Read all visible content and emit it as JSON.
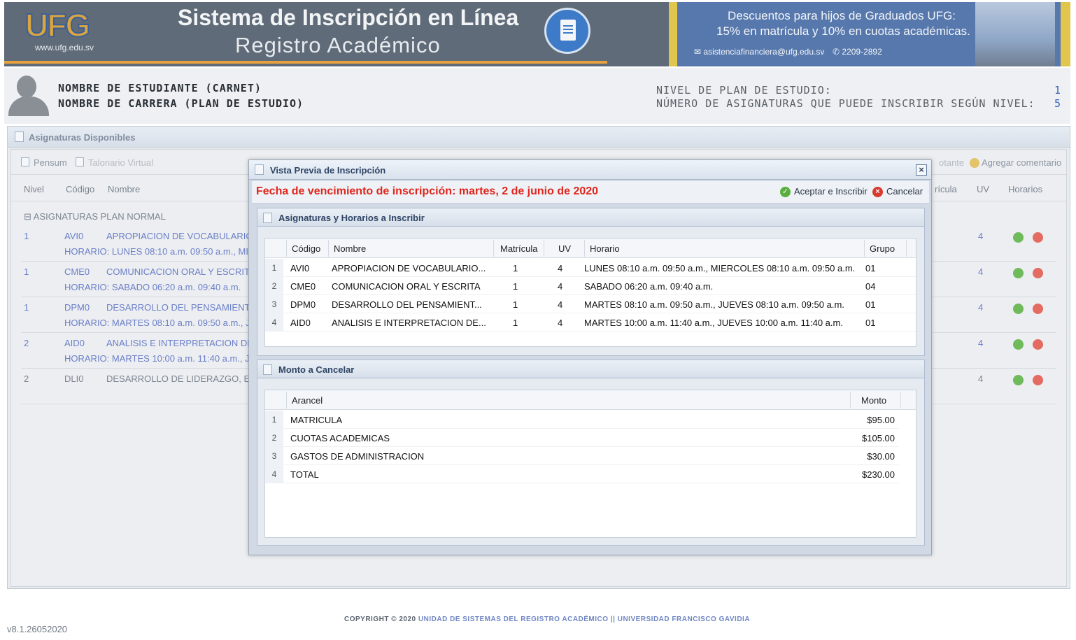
{
  "header": {
    "logo_text": "UFG",
    "logo_url": "www.ufg.edu.sv",
    "title": "Sistema de Inscripción en Línea",
    "subtitle": "Registro Académico",
    "promo_line1": "Descuentos para hijos de Graduados UFG:",
    "promo_line2": "15% en matrícula y 10% en cuotas académicas.",
    "promo_email": "asistenciafinanciera@ufg.edu.sv",
    "promo_phone": "2209-2892"
  },
  "student": {
    "name": "NOMBRE DE ESTUDIANTE (CARNET)",
    "career": "NOMBRE DE CARRERA (PLAN DE ESTUDIO)",
    "level_label": "NIVEL DE PLAN DE ESTUDIO:",
    "level_value": "1",
    "max_label": "NÚMERO DE ASIGNATURAS QUE PUEDE INSCRIBIR SEGÚN NIVEL:",
    "max_value": "5"
  },
  "background_panel": {
    "title": "Asignaturas Disponibles",
    "toolbar": {
      "pensum": "Pensum",
      "talonario": "Talonario Virtual",
      "cancel_partial": "otante",
      "comment": "Agregar comentario"
    },
    "columns": {
      "nivel": "Nivel",
      "codigo": "Código",
      "nombre": "Nombre",
      "matricula_partial": "rícula",
      "uv": "UV",
      "horarios": "Horarios"
    },
    "group_title": "ASIGNATURAS PLAN NORMAL",
    "rows": [
      {
        "nivel": "1",
        "codigo": "AVI0",
        "nombre": "APROPIACION DE VOCABULARIO",
        "horario": "HORARIO: LUNES 08:10 a.m. 09:50 a.m., MIE",
        "uv": "4"
      },
      {
        "nivel": "1",
        "codigo": "CME0",
        "nombre": "COMUNICACION ORAL Y ESCRITA",
        "horario": "HORARIO: SABADO 06:20 a.m. 09:40 a.m.",
        "uv": "4"
      },
      {
        "nivel": "1",
        "codigo": "DPM0",
        "nombre": "DESARROLLO DEL PENSAMIENT",
        "horario": "HORARIO: MARTES 08:10 a.m. 09:50 a.m., J",
        "uv": "4"
      },
      {
        "nivel": "2",
        "codigo": "AID0",
        "nombre": "ANALISIS E INTERPRETACION DE",
        "horario": "HORARIO: MARTES 10:00 a.m. 11:40 a.m., J",
        "uv": "4"
      },
      {
        "nivel": "2",
        "codigo": "DLI0",
        "nombre": "DESARROLLO DE LIDERAZGO, EM",
        "horario": "",
        "uv": "4"
      }
    ]
  },
  "dialog": {
    "title": "Vista Previa de Inscripción",
    "deadline": "Fecha de vencimiento de inscripción: martes, 2 de junio de 2020",
    "accept_label": "Aceptar e Inscribir",
    "cancel_label": "Cancelar",
    "subjects_panel": {
      "title": "Asignaturas y Horarios a Inscribir",
      "columns": {
        "codigo": "Código",
        "nombre": "Nombre",
        "matricula": "Matrícula",
        "uv": "UV",
        "horario": "Horario",
        "grupo": "Grupo"
      },
      "rows": [
        {
          "n": "1",
          "codigo": "AVI0",
          "nombre": "APROPIACION DE VOCABULARIO...",
          "matricula": "1",
          "uv": "4",
          "horario": "LUNES 08:10 a.m. 09:50 a.m., MIERCOLES 08:10 a.m. 09:50 a.m.",
          "grupo": "01"
        },
        {
          "n": "2",
          "codigo": "CME0",
          "nombre": "COMUNICACION ORAL Y ESCRITA",
          "matricula": "1",
          "uv": "4",
          "horario": "SABADO 06:20 a.m. 09:40 a.m.",
          "grupo": "04"
        },
        {
          "n": "3",
          "codigo": "DPM0",
          "nombre": "DESARROLLO DEL PENSAMIENT...",
          "matricula": "1",
          "uv": "4",
          "horario": "MARTES 08:10 a.m. 09:50 a.m., JUEVES 08:10 a.m. 09:50 a.m.",
          "grupo": "01"
        },
        {
          "n": "4",
          "codigo": "AID0",
          "nombre": "ANALISIS E INTERPRETACION DE...",
          "matricula": "1",
          "uv": "4",
          "horario": "MARTES 10:00 a.m. 11:40 a.m., JUEVES 10:00 a.m. 11:40 a.m.",
          "grupo": "01"
        }
      ]
    },
    "amount_panel": {
      "title": "Monto a Cancelar",
      "columns": {
        "arancel": "Arancel",
        "monto": "Monto"
      },
      "rows": [
        {
          "n": "1",
          "arancel": "MATRICULA",
          "monto": "$95.00"
        },
        {
          "n": "2",
          "arancel": "CUOTAS ACADEMICAS",
          "monto": "$105.00"
        },
        {
          "n": "3",
          "arancel": "GASTOS DE ADMINISTRACION",
          "monto": "$30.00"
        },
        {
          "n": "4",
          "arancel": "TOTAL",
          "monto": "$230.00"
        }
      ]
    }
  },
  "footer": {
    "copyright": "COPYRIGHT © 2020",
    "link1": "UNIDAD DE SISTEMAS DEL REGISTRO ACADÉMICO",
    "separator": "||",
    "link2": "UNIVERSIDAD FRANCISCO GAVIDIA",
    "version": "v8.1.26052020"
  },
  "colors": {
    "header_bg": "#5f6b78",
    "accent_orange": "#e6a23c",
    "promo_blue": "#5778ad",
    "deadline_red": "#e0251c",
    "link_blue": "#6b7fc8"
  }
}
